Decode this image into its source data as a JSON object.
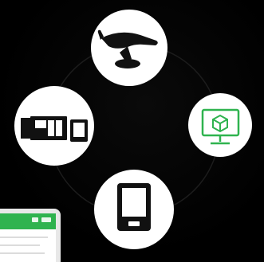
{
  "diagram": {
    "nodes": [
      {
        "id": "intraoral-scanner",
        "icon": "intraoral-scanner-icon"
      },
      {
        "id": "lab-workflow",
        "icon": "cad-monitor-icon",
        "accent": "#2fb34f"
      },
      {
        "id": "tablet-device",
        "icon": "tablet-device-icon"
      },
      {
        "id": "desktop-devices",
        "icon": "computer-devices-icon"
      }
    ],
    "laptop": {
      "accent": "#2fb34f",
      "icon": "laptop-icon"
    }
  }
}
